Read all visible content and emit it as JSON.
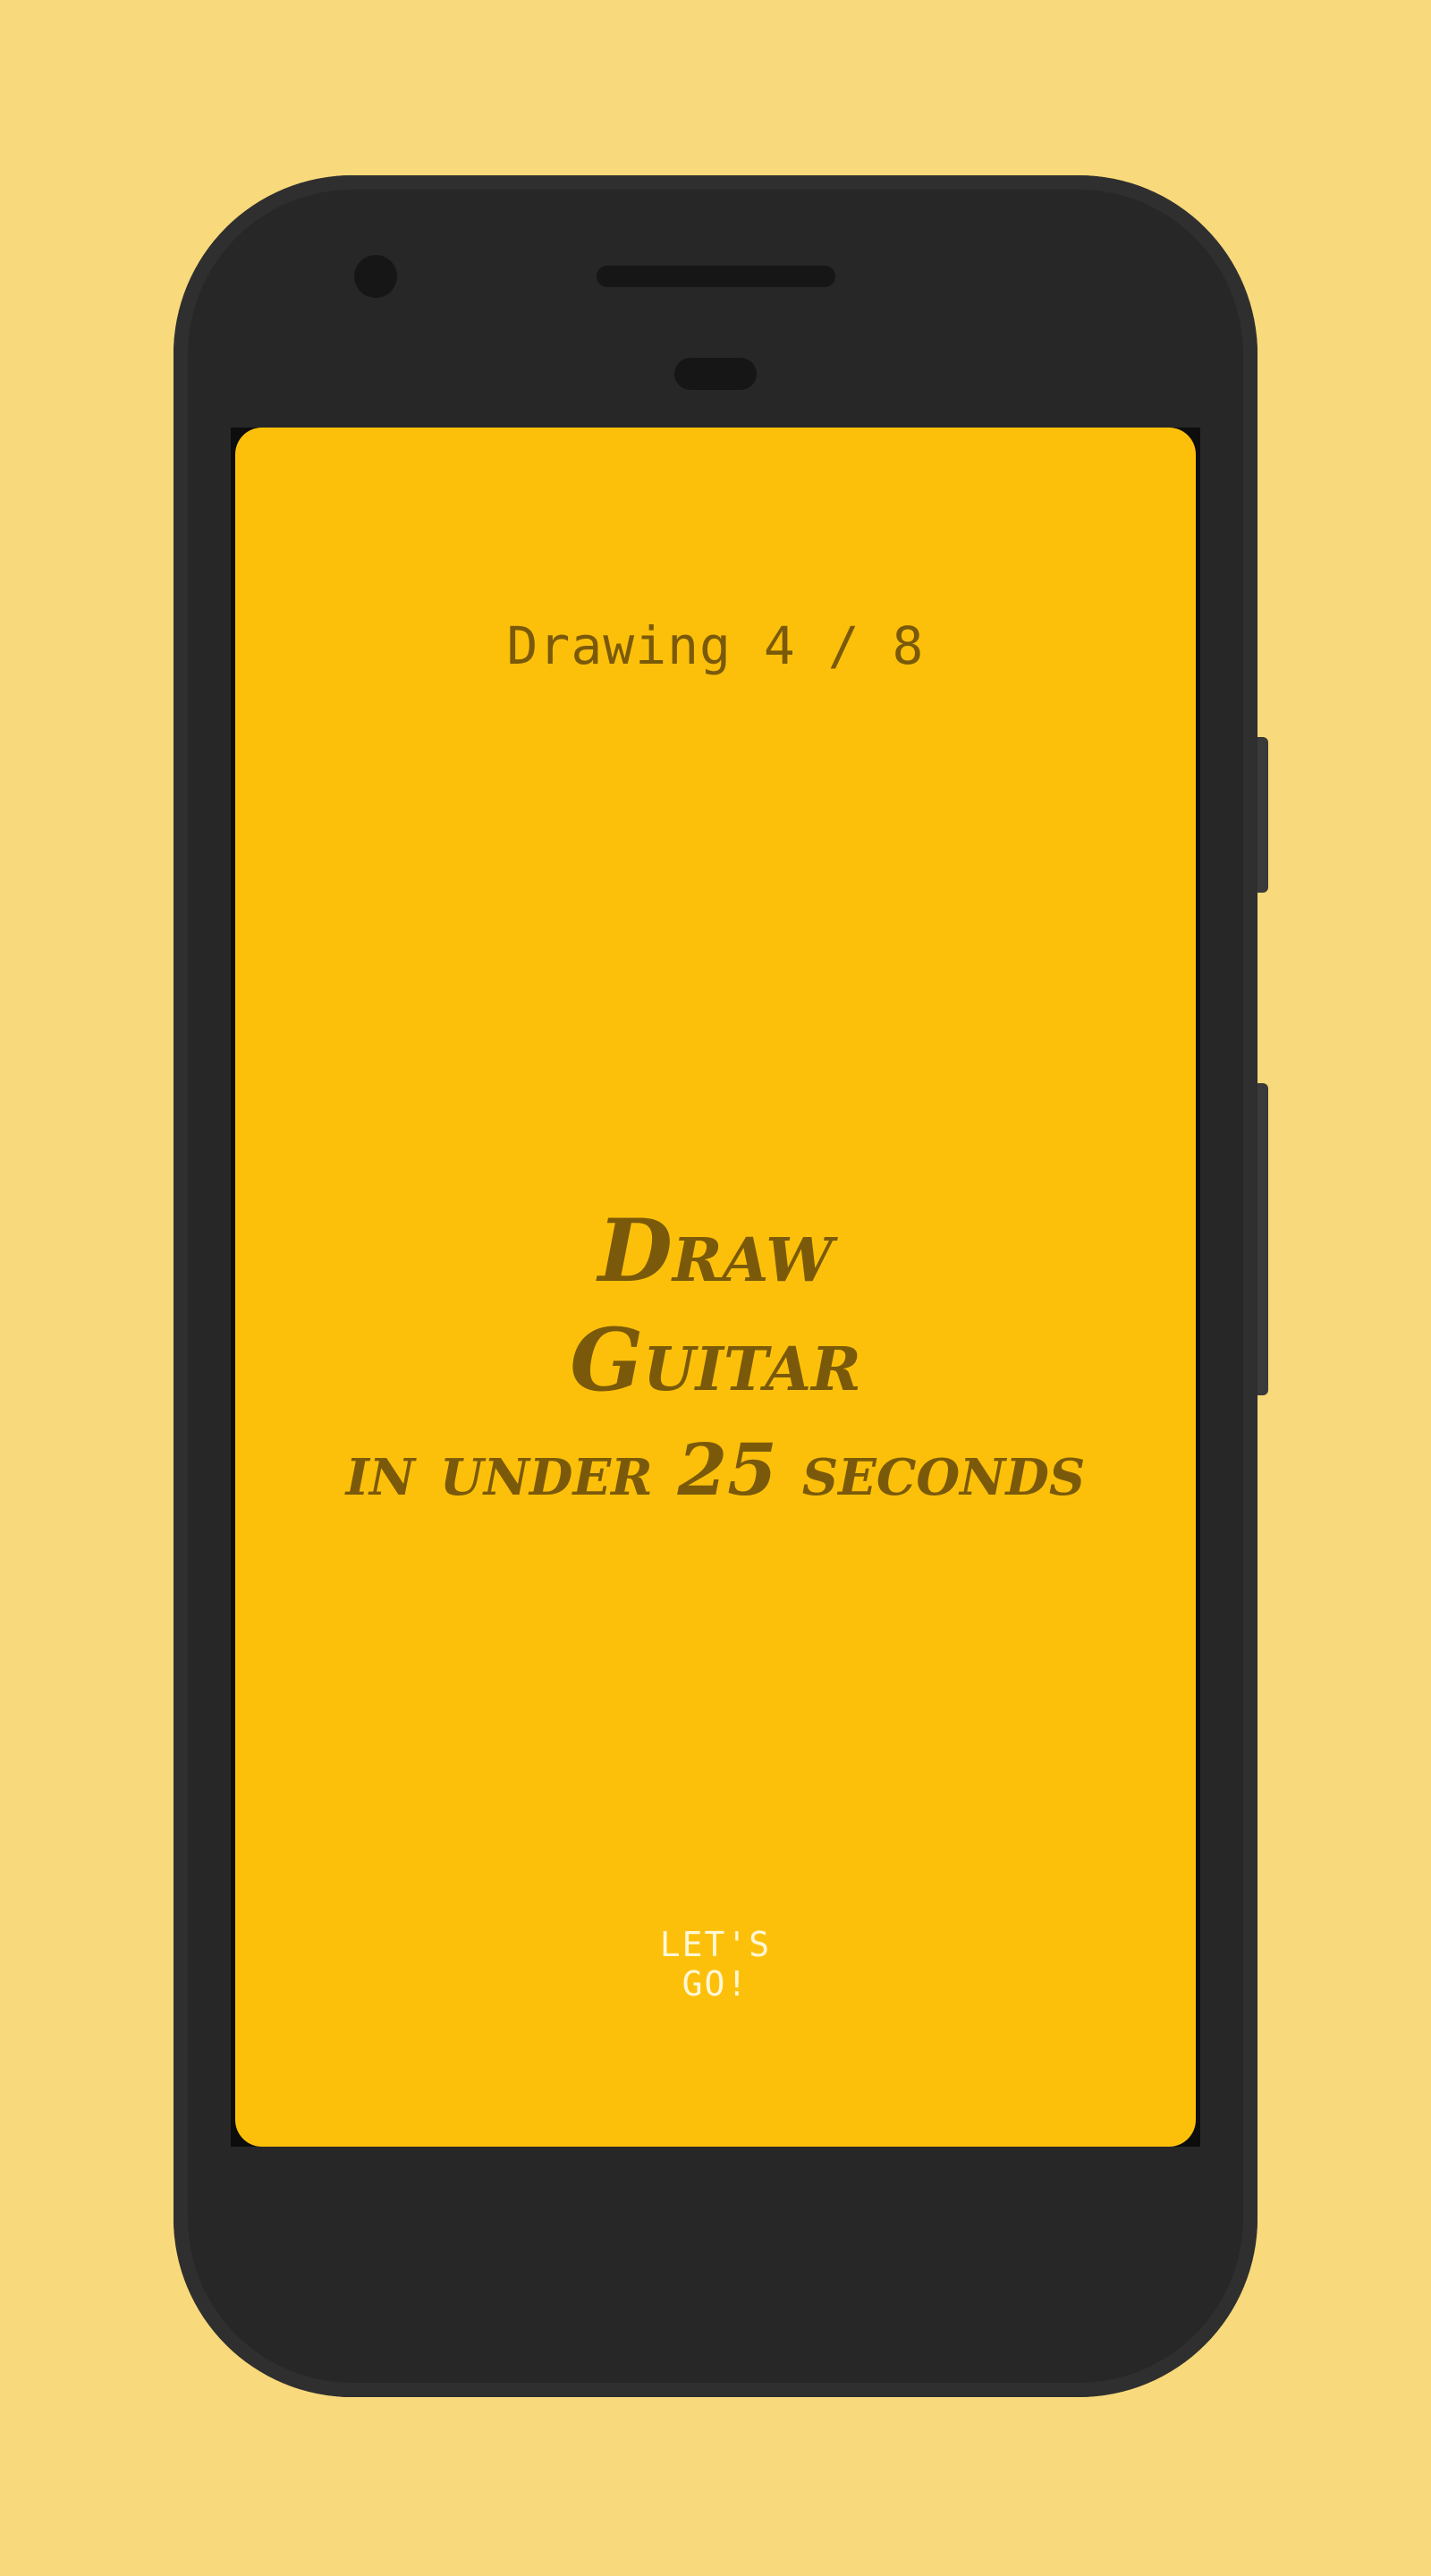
{
  "screen": {
    "counter": "Drawing 4 / 8",
    "prompt": {
      "line1": "Draw",
      "line2": "Guitar",
      "line3": "in under 25 seconds"
    },
    "cta_label": "LET'S GO!"
  },
  "colors": {
    "background": "#f8d97b",
    "screen": "#fdc00a",
    "text_dark": "#7a5a0a",
    "button_text": "#fff7d6",
    "phone_body": "#272727"
  }
}
